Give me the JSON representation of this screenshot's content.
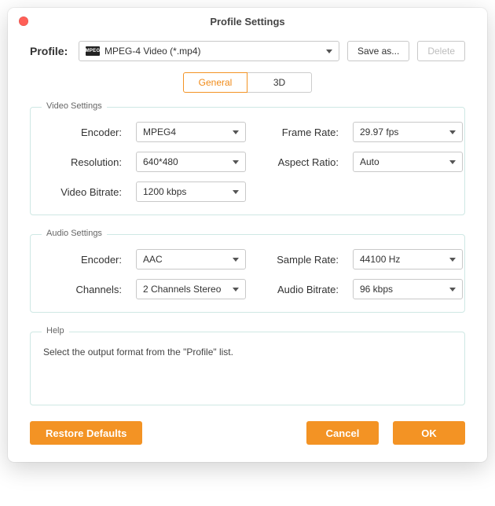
{
  "window": {
    "title": "Profile Settings"
  },
  "profile": {
    "label": "Profile:",
    "icon_text": "MPEG",
    "value": "MPEG-4 Video (*.mp4)",
    "saveas": "Save as...",
    "delete": "Delete"
  },
  "tabs": {
    "general": "General",
    "threeD": "3D"
  },
  "video": {
    "legend": "Video Settings",
    "encoder_label": "Encoder:",
    "encoder_value": "MPEG4",
    "framerate_label": "Frame Rate:",
    "framerate_value": "29.97 fps",
    "resolution_label": "Resolution:",
    "resolution_value": "640*480",
    "aspect_label": "Aspect Ratio:",
    "aspect_value": "Auto",
    "bitrate_label": "Video Bitrate:",
    "bitrate_value": "1200 kbps"
  },
  "audio": {
    "legend": "Audio Settings",
    "encoder_label": "Encoder:",
    "encoder_value": "AAC",
    "samplerate_label": "Sample Rate:",
    "samplerate_value": "44100 Hz",
    "channels_label": "Channels:",
    "channels_value": "2 Channels Stereo",
    "bitrate_label": "Audio Bitrate:",
    "bitrate_value": "96 kbps"
  },
  "help": {
    "legend": "Help",
    "text": "Select the output format from the \"Profile\" list."
  },
  "footer": {
    "restore": "Restore Defaults",
    "cancel": "Cancel",
    "ok": "OK"
  }
}
